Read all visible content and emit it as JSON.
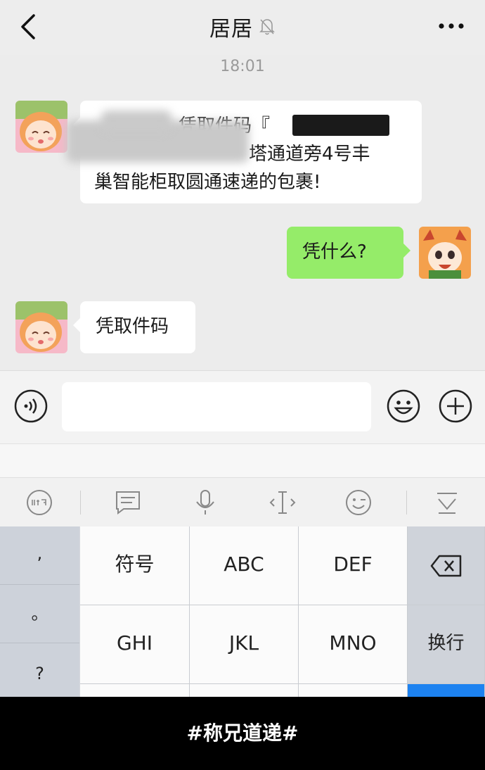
{
  "header": {
    "title": "居居",
    "back_icon": "chevron-left-icon",
    "mute_icon": "bell-muted-icon",
    "more_icon": "more-dots-icon"
  },
  "chat": {
    "timestamp": "18:01",
    "messages": [
      {
        "side": "left",
        "lines": [
          "凭取件码『",
          "塔通道旁4号丰",
          "巢智能柜取圆通速递的包裹!"
        ],
        "line1_suffix": "』"
      },
      {
        "side": "right",
        "text": "凭什么?"
      },
      {
        "side": "left",
        "text": "凭取件码"
      }
    ]
  },
  "input_bar": {
    "voice_icon": "voice-icon",
    "emoji_icon": "emoji-icon",
    "plus_icon": "plus-icon",
    "text_value": ""
  },
  "keyboard_toolbar": {
    "items": [
      "ime-icon",
      "message-icon",
      "mic-icon",
      "cursor-icon",
      "emoji-wink-icon",
      "collapse-keyboard-icon"
    ]
  },
  "keyboard": {
    "punctuation": [
      ",",
      "。",
      "?"
    ],
    "keys_row1": [
      "符号",
      "ABC",
      "DEF"
    ],
    "keys_row2": [
      "GHI",
      "JKL",
      "MNO"
    ],
    "enter_label": "换行",
    "delete_icon": "backspace-icon"
  },
  "caption": "#称兄道递#",
  "colors": {
    "sent_bubble": "#95ec69",
    "received_bubble": "#ffffff",
    "chat_background": "#ececec",
    "keyboard_accent": "#1d82f0"
  }
}
